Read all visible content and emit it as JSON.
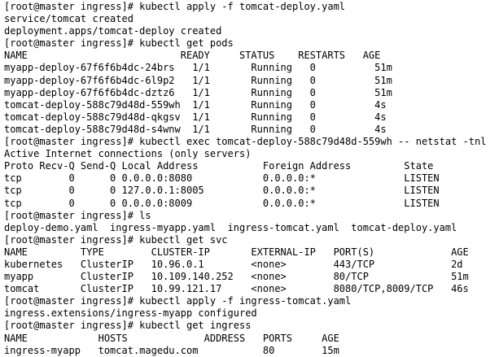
{
  "terminal": {
    "lines": [
      "[root@master ingress]# kubectl apply -f tomcat-deploy.yaml",
      "service/tomcat created",
      "deployment.apps/tomcat-deploy created",
      "[root@master ingress]# kubectl get pods",
      "NAME                          READY     STATUS    RESTARTS   AGE",
      "myapp-deploy-67f6f6b4dc-24brs   1/1       Running   0          51m",
      "myapp-deploy-67f6f6b4dc-6l9p2   1/1       Running   0          51m",
      "myapp-deploy-67f6f6b4dc-dztz6   1/1       Running   0          51m",
      "tomcat-deploy-588c79d48d-559wh  1/1       Running   0          4s",
      "tomcat-deploy-588c79d48d-qkgsv  1/1       Running   0          4s",
      "tomcat-deploy-588c79d48d-s4wnw  1/1       Running   0          4s",
      "[root@master ingress]# kubectl exec tomcat-deploy-588c79d48d-559wh -- netstat -tnl",
      "Active Internet connections (only servers)",
      "Proto Recv-Q Send-Q Local Address           Foreign Address         State",
      "tcp        0      0 0.0.0.0:8080            0.0.0.0:*               LISTEN",
      "tcp        0      0 127.0.0.1:8005          0.0.0.0:*               LISTEN",
      "tcp        0      0 0.0.0.0:8009            0.0.0.0:*               LISTEN",
      "[root@master ingress]# ls",
      "deploy-demo.yaml  ingress-myapp.yaml  ingress-tomcat.yaml  tomcat-deploy.yaml",
      "[root@master ingress]# kubectl get svc",
      "NAME         TYPE        CLUSTER-IP       EXTERNAL-IP   PORT(S)             AGE",
      "kubernetes   ClusterIP   10.96.0.1        <none>        443/TCP             2d",
      "myapp        ClusterIP   10.109.140.252   <none>        80/TCP              51m",
      "tomcat       ClusterIP   10.99.121.17     <none>        8080/TCP,8009/TCP   46s",
      "[root@master ingress]# kubectl apply -f ingress-tomcat.yaml",
      "ingress.extensions/ingress-myapp configured",
      "[root@master ingress]# kubectl get ingress",
      "NAME            HOSTS             ADDRESS   PORTS     AGE",
      "ingress-myapp   tomcat.magedu.com           80        15m"
    ]
  },
  "colors": {
    "background": "#ffffff",
    "foreground": "#000000"
  }
}
